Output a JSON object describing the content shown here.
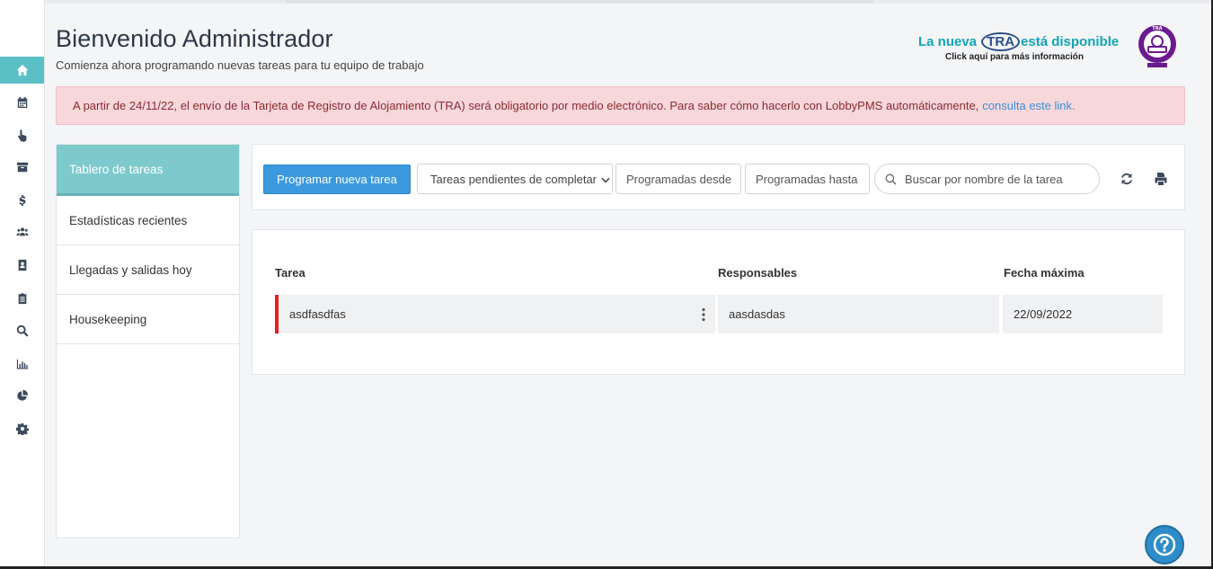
{
  "header": {
    "title": "Bienvenido Administrador",
    "subtitle": "Comienza ahora programando nuevas tareas para tu equipo de trabajo"
  },
  "tra_banner": {
    "prefix": "La nueva",
    "tra": "TRA",
    "suffix": "está disponible",
    "subtext": "Click aquí para más información",
    "logo_text": "TRA",
    "brand_color": "#12a4b8",
    "logo_color": "#6a1b8f"
  },
  "alert": {
    "text": "A partir de 24/11/22, el envío de la Tarjeta de Registro de Alojamiento (TRA) será obligatorio por medio electrónico. Para saber cómo hacerlo con LobbyPMS automáticamente,",
    "link_text": "consulta este link."
  },
  "sidebar": {
    "items": [
      {
        "icon": "home-icon",
        "active": true
      },
      {
        "icon": "calendar-icon"
      },
      {
        "icon": "hand-pointer-icon"
      },
      {
        "icon": "archive-icon"
      },
      {
        "icon": "dollar-icon"
      },
      {
        "icon": "users-icon"
      },
      {
        "icon": "contact-book-icon"
      },
      {
        "icon": "clipboard-icon"
      },
      {
        "icon": "search-icon"
      },
      {
        "icon": "bar-chart-icon"
      },
      {
        "icon": "pie-chart-icon"
      },
      {
        "icon": "gear-icon"
      }
    ]
  },
  "left_menu": {
    "items": [
      {
        "label": "Tablero de tareas",
        "active": true
      },
      {
        "label": "Estadísticas recientes"
      },
      {
        "label": "Llegadas y salidas hoy"
      },
      {
        "label": "Housekeeping"
      }
    ]
  },
  "toolbar": {
    "new_task_label": "Programar nueva tarea",
    "status_select_value": "Tareas pendientes de completar",
    "from_placeholder": "Programadas desde",
    "to_placeholder": "Programadas hasta",
    "search_placeholder": "Buscar por nombre de la tarea",
    "refresh_icon": "refresh-icon",
    "print_icon": "print-icon"
  },
  "table": {
    "columns": [
      "Tarea",
      "Responsables",
      "Fecha máxima"
    ],
    "rows": [
      {
        "task": "asdfasdfas",
        "responsible": "aasdasdas",
        "due": "22/09/2022",
        "priority_color": "#e52020"
      }
    ]
  },
  "colors": {
    "accent": "#5bbfc6",
    "primary_button": "#3b99dd",
    "alert_bg": "#f7d7da",
    "help_button": "#2e8dc9"
  }
}
